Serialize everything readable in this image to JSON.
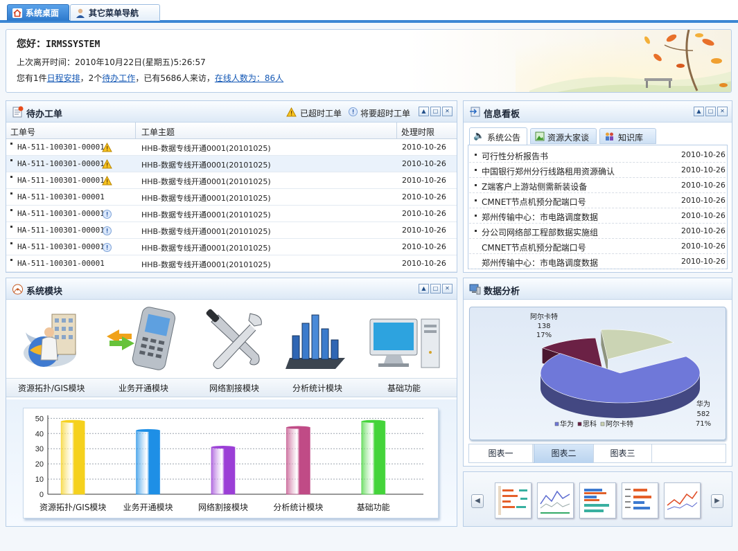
{
  "tabs": [
    {
      "label": "系统桌面",
      "icon": "home-icon",
      "active": true
    },
    {
      "label": "其它菜单导航",
      "icon": "user-icon",
      "active": false
    }
  ],
  "welcome": {
    "greeting_prefix": "您好：",
    "username": "IRMSSYSTEM",
    "last_left_prefix": "上次离开时间：",
    "last_left_time": "2010年10月22日(星期五)5:26:57",
    "summary_a": "您有1件",
    "schedule_link": "日程安排",
    "summary_b": "，2个",
    "todo_link": "待办工作",
    "summary_c": "，已有5686人来访，",
    "online_link": "在线人数为：86人"
  },
  "todo": {
    "title": "待办工单",
    "legend_overdue": "已超时工单",
    "legend_soon": "将要超时工单",
    "columns": [
      "工单号",
      "工单主题",
      "处理时限"
    ],
    "rows": [
      {
        "id": "HA-511-100301-00001",
        "status": "overdue",
        "subject": "HHB-数据专线开通0001(20101025)",
        "deadline": "2010-10-26"
      },
      {
        "id": "HA-511-100301-00001",
        "status": "overdue",
        "subject": "HHB-数据专线开通0001(20101025)",
        "deadline": "2010-10-26"
      },
      {
        "id": "HA-511-100301-00001",
        "status": "overdue",
        "subject": "HHB-数据专线开通0001(20101025)",
        "deadline": "2010-10-26"
      },
      {
        "id": "HA-511-100301-00001",
        "status": "none",
        "subject": "HHB-数据专线开通0001(20101025)",
        "deadline": "2010-10-26"
      },
      {
        "id": "HA-511-100301-00001",
        "status": "soon",
        "subject": "HHB-数据专线开通0001(20101025)",
        "deadline": "2010-10-26"
      },
      {
        "id": "HA-511-100301-00001",
        "status": "soon",
        "subject": "HHB-数据专线开通0001(20101025)",
        "deadline": "2010-10-26"
      },
      {
        "id": "HA-511-100301-00001",
        "status": "soon",
        "subject": "HHB-数据专线开通0001(20101025)",
        "deadline": "2010-10-26"
      },
      {
        "id": "HA-511-100301-00001",
        "status": "none",
        "subject": "HHB-数据专线开通0001(20101025)",
        "deadline": "2010-10-26"
      }
    ]
  },
  "info": {
    "title": "信息看板",
    "tabs": [
      {
        "label": "系统公告",
        "icon": "speaker-icon"
      },
      {
        "label": "资源大家谈",
        "icon": "picture-icon"
      },
      {
        "label": "知识库",
        "icon": "people-icon"
      }
    ],
    "items": [
      {
        "text": "可行性分析报告书",
        "date": "2010-10-26",
        "bullet": true
      },
      {
        "text": "中国银行郑州分行线路租用资源确认",
        "date": "2010-10-26",
        "bullet": true
      },
      {
        "text": "Z端客户上游站侧需新装设备",
        "date": "2010-10-26",
        "bullet": true
      },
      {
        "text": "CMNET节点机预分配端口号",
        "date": "2010-10-26",
        "bullet": true
      },
      {
        "text": "郑州传输中心：市电路调度数据",
        "date": "2010-10-26",
        "bullet": true
      },
      {
        "text": "分公司网络部工程部数据实施组",
        "date": "2010-10-26",
        "bullet": true
      },
      {
        "text": "CMNET节点机预分配端口号",
        "date": "2010-10-26",
        "bullet": false
      },
      {
        "text": "郑州传输中心：市电路调度数据",
        "date": "2010-10-26",
        "bullet": false
      }
    ]
  },
  "modules": {
    "title": "系统模块",
    "items": [
      {
        "label": "资源拓扑/GIS模块",
        "icon": "building-user-icon"
      },
      {
        "label": "业务开通模块",
        "icon": "mobile-phone-icon"
      },
      {
        "label": "网络割接模块",
        "icon": "tools-icon"
      },
      {
        "label": "分析统计模块",
        "icon": "bar-chart-icon"
      },
      {
        "label": "基础功能",
        "icon": "computer-icon"
      }
    ]
  },
  "chart_data": [
    {
      "type": "bar",
      "categories": [
        "资源拓扑/GIS模块",
        "业务开通模块",
        "网络割接模块",
        "分析统计模块",
        "基础功能"
      ],
      "values": [
        48,
        42,
        31,
        44,
        48
      ],
      "colors": [
        "#f5d11d",
        "#1e8fe6",
        "#9b3fd6",
        "#c04b86",
        "#44d43a"
      ],
      "yticks": [
        0,
        10,
        20,
        30,
        40,
        50
      ],
      "ylim": [
        0,
        52
      ],
      "grid": true
    },
    {
      "type": "pie",
      "labels": [
        "华为",
        "思科",
        "阿尔卡特"
      ],
      "values": [
        582,
        100,
        138
      ],
      "percent_labels": [
        "71%",
        "",
        "17%"
      ],
      "colors": [
        "#6f78d9",
        "#6b2145",
        "#cbd4b4"
      ],
      "annotations": [
        {
          "name": "阿尔卡特",
          "value": "138",
          "percent": "17%"
        },
        {
          "name": "华为",
          "value": "582",
          "percent": "71%"
        }
      ],
      "legend_position": "bottom"
    }
  ],
  "analysis": {
    "title": "数据分析",
    "subtabs": [
      "图表一",
      "图表二",
      "图表三"
    ],
    "active_subtab": "图表二"
  },
  "carousel": {
    "prev_icon": "chevron-left-icon",
    "next_icon": "chevron-right-icon",
    "thumbs": [
      "bar-thumb",
      "line-thumb",
      "bar-thumb",
      "bar-thumb",
      "line-thumb"
    ]
  }
}
